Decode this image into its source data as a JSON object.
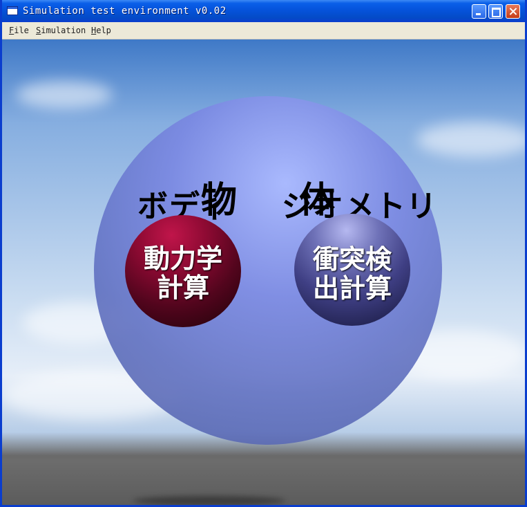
{
  "window": {
    "title": "Simulation test environment v0.02",
    "icons": [
      "app-icon",
      "minimize-icon",
      "maximize-icon",
      "close-icon"
    ]
  },
  "menu": {
    "items": [
      "File",
      "Simulation",
      "Help"
    ]
  },
  "scene": {
    "object_title": "物 体",
    "body_label": "ボディ",
    "geometry_label": "ジオメトリ",
    "dynamics": {
      "line1": "動力学",
      "line2": "計算"
    },
    "collision": {
      "line1": "衝突検",
      "line2": "出計算"
    }
  }
}
